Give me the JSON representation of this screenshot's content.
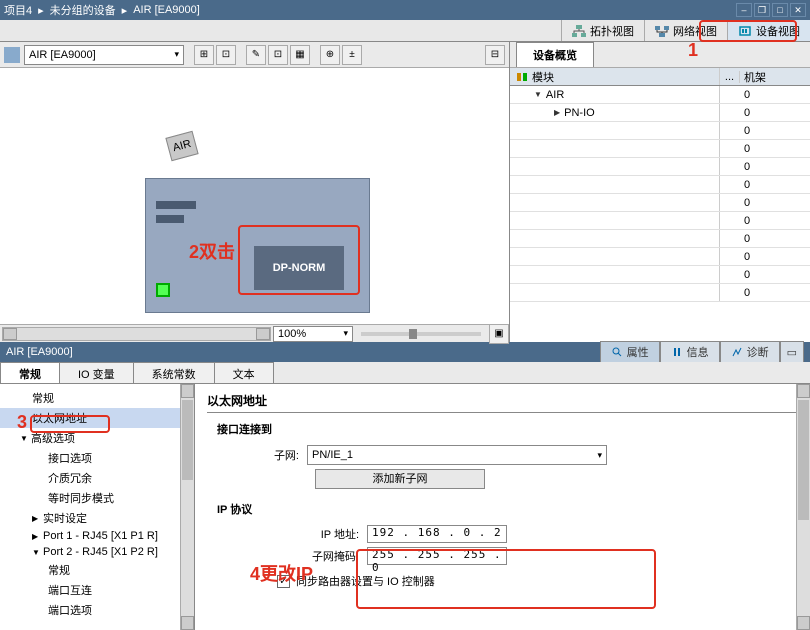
{
  "breadcrumb": {
    "p1": "项目4",
    "p2": "未分组的设备",
    "p3": "AIR [EA9000]"
  },
  "view_tabs": {
    "topo": "拓扑视图",
    "net": "网络视图",
    "dev": "设备视图"
  },
  "annotations": {
    "a1": "1",
    "a2": "2双击",
    "a3": "3",
    "a4": "4更改IP"
  },
  "device_select": "AIR [EA9000]",
  "device_label": "AIR",
  "dp_norm": "DP-NORM",
  "zoom": "100%",
  "overview": {
    "tab": "设备概览",
    "col_module": "模块",
    "col_rack": "机架",
    "ellipsis": "...",
    "rows": [
      {
        "indent": 1,
        "arrow": "▼",
        "label": "AIR",
        "rack": "0"
      },
      {
        "indent": 2,
        "arrow": "▶",
        "label": "PN-IO",
        "rack": "0"
      }
    ],
    "empty_rack": "0"
  },
  "prop_title": "AIR [EA9000]",
  "prop_rtabs": {
    "prop": "属性",
    "info": "信息",
    "diag": "诊断"
  },
  "main_tabs": {
    "t1": "常规",
    "t2": "IO 变量",
    "t3": "系统常数",
    "t4": "文本"
  },
  "tree": {
    "i0": "常规",
    "i1": "以太网地址",
    "i2": "高级选项",
    "i3": "接口选项",
    "i4": "介质冗余",
    "i5": "等时同步模式",
    "i6": "实时设定",
    "i7": "Port 1 - RJ45 [X1 P1 R]",
    "i8": "Port 2 - RJ45 [X1 P2 R]",
    "i9": "常规",
    "i10": "端口互连",
    "i11": "端口选项"
  },
  "detail": {
    "title": "以太网地址",
    "sec1": "接口连接到",
    "subnet_label": "子网:",
    "subnet_value": "PN/IE_1",
    "add_subnet": "添加新子网",
    "sec2": "IP 协议",
    "ip_label": "IP 地址:",
    "ip_value": "192 . 168 .  0  .  2",
    "mask_label": "子网掩码:",
    "mask_value": "255 . 255 . 255 .  0",
    "cb_label": "同步路由器设置与 IO 控制器"
  }
}
